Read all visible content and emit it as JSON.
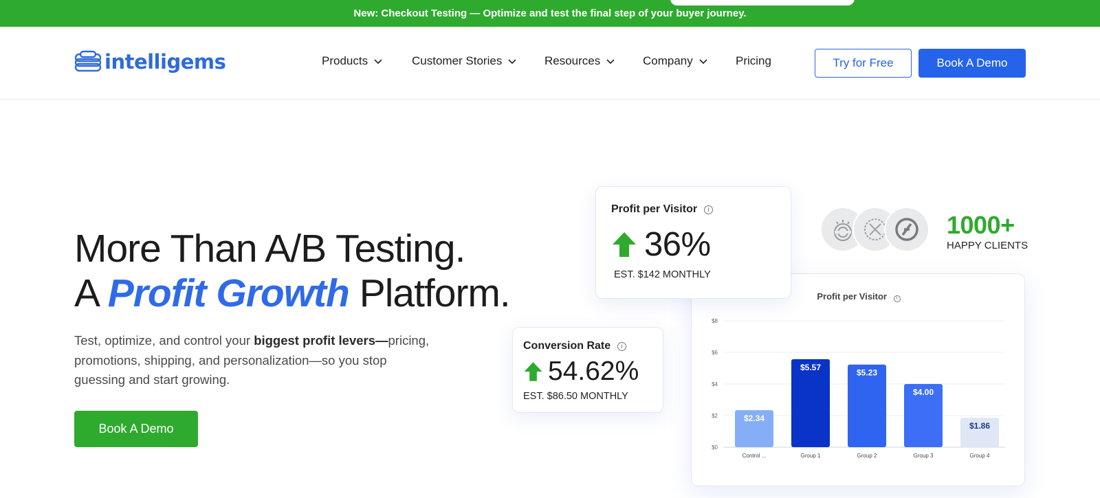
{
  "banner": {
    "text": "New: Checkout Testing — Optimize and test the final step of your buyer journey."
  },
  "header": {
    "logo_text": "intelligems",
    "nav": [
      {
        "label": "Products",
        "has_dropdown": true
      },
      {
        "label": "Customer Stories",
        "has_dropdown": true
      },
      {
        "label": "Resources",
        "has_dropdown": true
      },
      {
        "label": "Company",
        "has_dropdown": true
      },
      {
        "label": "Pricing",
        "has_dropdown": false
      }
    ],
    "try_free_label": "Try for Free",
    "book_demo_label": "Book A Demo"
  },
  "hero": {
    "line1": "More Than A/B Testing.",
    "line2_prefix": "A ",
    "line2_accent": "Profit Growth",
    "line2_suffix": " Platform.",
    "subtitle_before": "Test, optimize, and control your ",
    "subtitle_bold": "biggest profit levers—",
    "subtitle_after": "pricing, promotions, shipping, and personalization—so you stop guessing and start growing.",
    "cta_label": "Book A Demo"
  },
  "profit_card": {
    "title": "Profit per Visitor",
    "info_symbol": "i",
    "value": "36%",
    "estimate": "EST. $142 MONTHLY"
  },
  "conversion_card": {
    "title": "Conversion Rate",
    "info_symbol": "i",
    "value": "54.62%",
    "estimate": "EST. $86.50 MONTHLY"
  },
  "clients": {
    "count": "1000+",
    "label": "HAPPY CLIENTS"
  },
  "colors": {
    "green": "#2eaa2e",
    "blue": "#2563eb",
    "accent_text": "#2f6be8"
  },
  "chart_data": {
    "type": "bar",
    "title": "Profit per Visitor",
    "categories": [
      "Control ...",
      "Group 1",
      "Group 2",
      "Group 3",
      "Group 4"
    ],
    "values": [
      2.34,
      5.57,
      5.23,
      4.0,
      1.86
    ],
    "value_labels": [
      "$2.34",
      "$5.57",
      "$5.23",
      "$4.00",
      "$1.86"
    ],
    "bar_colors": [
      "#85aef7",
      "#0a34c8",
      "#2f64f0",
      "#3c6ff5",
      "#dfe6f5"
    ],
    "label_colors": [
      "#ffffff",
      "#ffffff",
      "#ffffff",
      "#ffffff",
      "#1e3a8a"
    ],
    "yticks": [
      "$0",
      "$2",
      "$4",
      "$6",
      "$8"
    ],
    "ylim": [
      0,
      8
    ],
    "grid": true
  }
}
